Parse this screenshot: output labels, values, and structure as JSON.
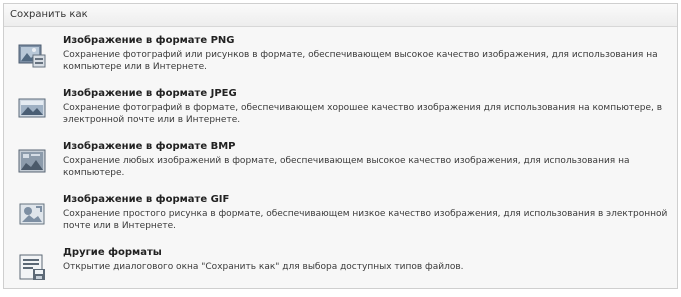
{
  "menu": {
    "title": "Сохранить как",
    "items": [
      {
        "title": "Изображение в формате PNG",
        "description": "Сохранение фотографий или рисунков в формате, обеспечивающем высокое качество изображения, для использования на компьютере или в Интернете.",
        "icon": "png-image-icon"
      },
      {
        "title": "Изображение в формате JPEG",
        "description": "Сохранение фотографий в формате, обеспечивающем хорошее качество изображения для использования на компьютере, в электронной почте или в Интернете.",
        "icon": "jpeg-image-icon"
      },
      {
        "title": "Изображение в формате BMP",
        "description": "Сохранение любых изображений в формате, обеспечивающем высокое качество изображения, для использования на компьютере.",
        "icon": "bmp-image-icon"
      },
      {
        "title": "Изображение в формате GIF",
        "description": "Сохранение простого рисунка в формате, обеспечивающем низкое качество изображения, для использования в электронной почте или в Интернете.",
        "icon": "gif-image-icon"
      },
      {
        "title": "Другие форматы",
        "description": "Открытие диалогового окна \"Сохранить как\" для выбора доступных типов файлов.",
        "icon": "save-as-dialog-icon"
      }
    ]
  }
}
